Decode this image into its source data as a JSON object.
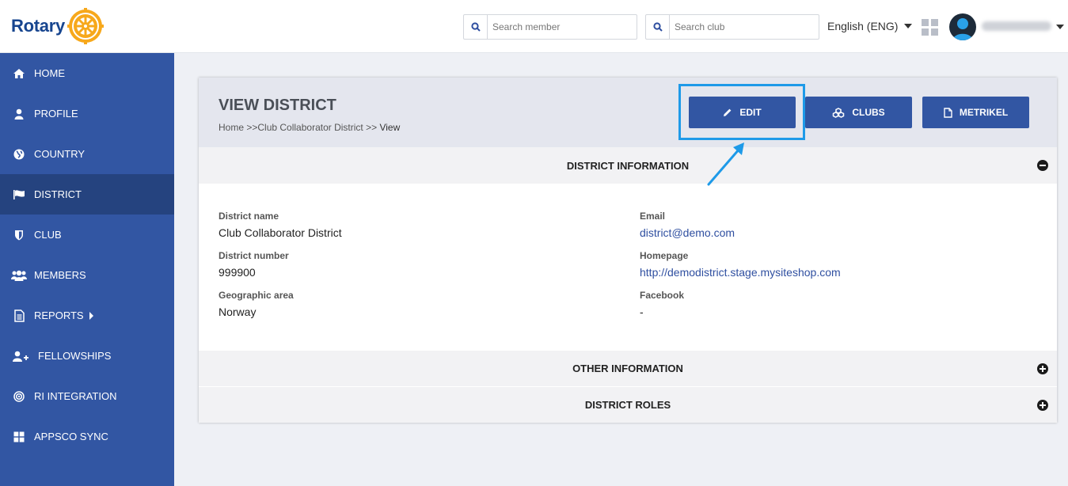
{
  "brand": {
    "name": "Rotary",
    "color": "#17458f",
    "wheel_color": "#f7a81b"
  },
  "header": {
    "search_member_placeholder": "Search member",
    "search_club_placeholder": "Search club",
    "language": "English (ENG)",
    "apps_icon": "grid-icon",
    "avatar_icon": "user-avatar"
  },
  "sidebar": {
    "color": "#3256a3",
    "active_color": "#25437f",
    "items": [
      {
        "label": "HOME",
        "icon": "home-icon"
      },
      {
        "label": "PROFILE",
        "icon": "user-icon"
      },
      {
        "label": "COUNTRY",
        "icon": "globe-icon"
      },
      {
        "label": "DISTRICT",
        "icon": "flag-icon",
        "active": true
      },
      {
        "label": "CLUB",
        "icon": "shield-icon"
      },
      {
        "label": "MEMBERS",
        "icon": "users-icon"
      },
      {
        "label": "REPORTS",
        "icon": "document-icon",
        "has_submenu": true
      },
      {
        "label": "FELLOWSHIPS",
        "icon": "user-plus-icon"
      },
      {
        "label": "RI INTEGRATION",
        "icon": "target-icon"
      },
      {
        "label": "APPSCO SYNC",
        "icon": "apps-icon"
      }
    ]
  },
  "page": {
    "title": "VIEW DISTRICT",
    "breadcrumb": {
      "home": "Home",
      "sep1": " >>",
      "mid": "Club Collaborator District",
      "sep2": " >> ",
      "current": "View"
    },
    "buttons": {
      "edit": "EDIT",
      "clubs": "CLUBS",
      "metrikel": "METRIKEL"
    }
  },
  "sections": {
    "district_information": "DISTRICT INFORMATION",
    "other_information": "OTHER INFORMATION",
    "district_roles": "DISTRICT ROLES"
  },
  "fields": {
    "district_name": {
      "label": "District name",
      "value": "Club Collaborator District"
    },
    "district_number": {
      "label": "District number",
      "value": "999900"
    },
    "geographic_area": {
      "label": "Geographic area",
      "value": "Norway"
    },
    "email": {
      "label": "Email",
      "value": "district@demo.com"
    },
    "homepage": {
      "label": "Homepage",
      "value": "http://demodistrict.stage.mysiteshop.com"
    },
    "facebook": {
      "label": "Facebook",
      "value": "-"
    }
  },
  "annotation": {
    "highlight_color": "#1e9ae8"
  }
}
